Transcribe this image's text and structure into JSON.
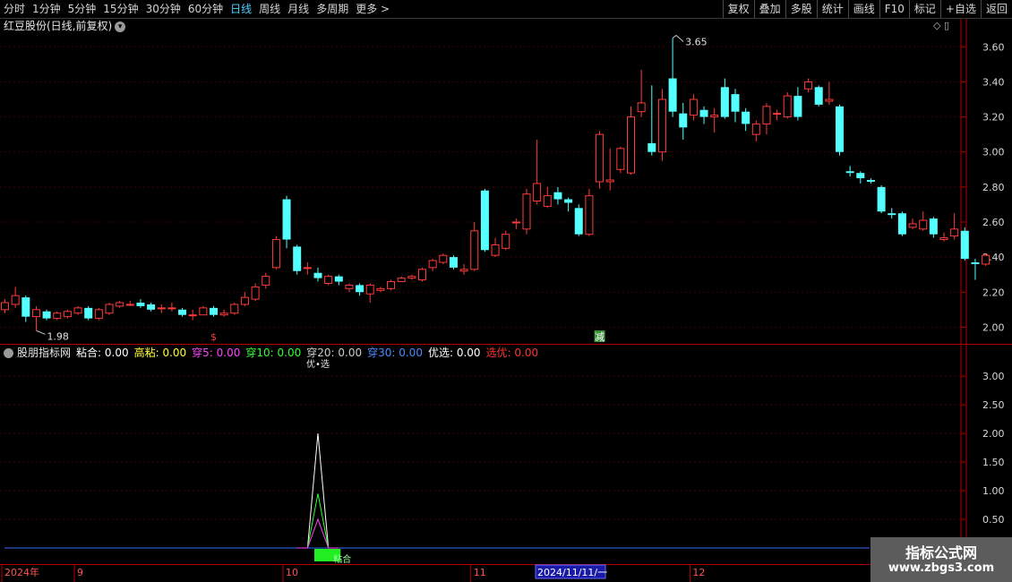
{
  "toolbar": {
    "periods": [
      "分时",
      "1分钟",
      "5分钟",
      "15分钟",
      "30分钟",
      "60分钟",
      "日线",
      "周线",
      "月线",
      "多周期",
      "更多 >"
    ],
    "active_period": "日线",
    "tools": [
      "复权",
      "叠加",
      "多股",
      "统计",
      "画线",
      "F10",
      "标记",
      "+自选",
      "返回"
    ]
  },
  "chart_header": {
    "title": "红豆股份(日线,前复权)",
    "icons": "◇ ▯"
  },
  "colors": {
    "up": "#ff3a3a",
    "down": "#54ffff",
    "axis": "#b30000",
    "grid": "#3a0000"
  },
  "chart_data": [
    {
      "type": "candlestick",
      "title": "红豆股份(日线,前复权)",
      "y_ticks": [
        "3.60",
        "3.40",
        "3.20",
        "3.00",
        "2.80",
        "2.60",
        "2.40",
        "2.20",
        "2.00"
      ],
      "ylim": [
        1.91,
        3.76
      ],
      "annotations": {
        "high": "3.65",
        "low": "1.98"
      },
      "signal_markers": [
        {
          "index": 20,
          "label": "$",
          "color": "#ff3a3a"
        },
        {
          "index": 57,
          "label": "减",
          "color": "#ffffff"
        }
      ],
      "candles": [
        {
          "o": 2.1,
          "c": 2.14,
          "h": 2.16,
          "l": 2.08
        },
        {
          "o": 2.13,
          "c": 2.18,
          "h": 2.23,
          "l": 2.11
        },
        {
          "o": 2.17,
          "c": 2.06,
          "h": 2.18,
          "l": 2.03
        },
        {
          "o": 2.06,
          "c": 2.1,
          "h": 2.12,
          "l": 1.98
        },
        {
          "o": 2.09,
          "c": 2.05,
          "h": 2.1,
          "l": 2.04
        },
        {
          "o": 2.05,
          "c": 2.08,
          "h": 2.09,
          "l": 2.04
        },
        {
          "o": 2.06,
          "c": 2.09,
          "h": 2.1,
          "l": 2.05
        },
        {
          "o": 2.08,
          "c": 2.11,
          "h": 2.12,
          "l": 2.07
        },
        {
          "o": 2.11,
          "c": 2.05,
          "h": 2.12,
          "l": 2.04
        },
        {
          "o": 2.05,
          "c": 2.1,
          "h": 2.11,
          "l": 2.04
        },
        {
          "o": 2.08,
          "c": 2.13,
          "h": 2.14,
          "l": 2.07
        },
        {
          "o": 2.12,
          "c": 2.14,
          "h": 2.15,
          "l": 2.11
        },
        {
          "o": 2.13,
          "c": 2.13,
          "h": 2.15,
          "l": 2.12
        },
        {
          "o": 2.14,
          "c": 2.12,
          "h": 2.16,
          "l": 2.11
        },
        {
          "o": 2.13,
          "c": 2.1,
          "h": 2.14,
          "l": 2.09
        },
        {
          "o": 2.11,
          "c": 2.11,
          "h": 2.13,
          "l": 2.08
        },
        {
          "o": 2.11,
          "c": 2.11,
          "h": 2.14,
          "l": 2.09
        },
        {
          "o": 2.1,
          "c": 2.07,
          "h": 2.11,
          "l": 2.06
        },
        {
          "o": 2.07,
          "c": 2.07,
          "h": 2.1,
          "l": 2.04
        },
        {
          "o": 2.07,
          "c": 2.11,
          "h": 2.12,
          "l": 2.07
        },
        {
          "o": 2.11,
          "c": 2.07,
          "h": 2.12,
          "l": 2.06
        },
        {
          "o": 2.07,
          "c": 2.08,
          "h": 2.1,
          "l": 2.06
        },
        {
          "o": 2.08,
          "c": 2.13,
          "h": 2.14,
          "l": 2.07
        },
        {
          "o": 2.13,
          "c": 2.17,
          "h": 2.2,
          "l": 2.12
        },
        {
          "o": 2.16,
          "c": 2.23,
          "h": 2.25,
          "l": 2.15
        },
        {
          "o": 2.24,
          "c": 2.29,
          "h": 2.31,
          "l": 2.22
        },
        {
          "o": 2.34,
          "c": 2.5,
          "h": 2.52,
          "l": 2.33
        },
        {
          "o": 2.73,
          "c": 2.5,
          "h": 2.75,
          "l": 2.45
        },
        {
          "o": 2.46,
          "c": 2.32,
          "h": 2.47,
          "l": 2.3
        },
        {
          "o": 2.34,
          "c": 2.34,
          "h": 2.37,
          "l": 2.3
        },
        {
          "o": 2.31,
          "c": 2.28,
          "h": 2.34,
          "l": 2.26
        },
        {
          "o": 2.25,
          "c": 2.29,
          "h": 2.3,
          "l": 2.24
        },
        {
          "o": 2.29,
          "c": 2.26,
          "h": 2.3,
          "l": 2.24
        },
        {
          "o": 2.22,
          "c": 2.24,
          "h": 2.25,
          "l": 2.2
        },
        {
          "o": 2.24,
          "c": 2.2,
          "h": 2.25,
          "l": 2.18
        },
        {
          "o": 2.19,
          "c": 2.24,
          "h": 2.25,
          "l": 2.14
        },
        {
          "o": 2.21,
          "c": 2.22,
          "h": 2.23,
          "l": 2.2
        },
        {
          "o": 2.22,
          "c": 2.26,
          "h": 2.27,
          "l": 2.21
        },
        {
          "o": 2.26,
          "c": 2.28,
          "h": 2.29,
          "l": 2.26
        },
        {
          "o": 2.28,
          "c": 2.29,
          "h": 2.3,
          "l": 2.27
        },
        {
          "o": 2.27,
          "c": 2.33,
          "h": 2.34,
          "l": 2.26
        },
        {
          "o": 2.34,
          "c": 2.38,
          "h": 2.39,
          "l": 2.32
        },
        {
          "o": 2.37,
          "c": 2.41,
          "h": 2.42,
          "l": 2.36
        },
        {
          "o": 2.4,
          "c": 2.34,
          "h": 2.41,
          "l": 2.33
        },
        {
          "o": 2.32,
          "c": 2.33,
          "h": 2.36,
          "l": 2.3
        },
        {
          "o": 2.33,
          "c": 2.55,
          "h": 2.6,
          "l": 2.32
        },
        {
          "o": 2.78,
          "c": 2.44,
          "h": 2.79,
          "l": 2.43
        },
        {
          "o": 2.41,
          "c": 2.47,
          "h": 2.51,
          "l": 2.4
        },
        {
          "o": 2.45,
          "c": 2.53,
          "h": 2.55,
          "l": 2.44
        },
        {
          "o": 2.6,
          "c": 2.6,
          "h": 2.62,
          "l": 2.56
        },
        {
          "o": 2.56,
          "c": 2.76,
          "h": 2.79,
          "l": 2.53
        },
        {
          "o": 2.72,
          "c": 2.82,
          "h": 3.07,
          "l": 2.7
        },
        {
          "o": 2.69,
          "c": 2.75,
          "h": 2.8,
          "l": 2.68
        },
        {
          "o": 2.77,
          "c": 2.73,
          "h": 2.8,
          "l": 2.7
        },
        {
          "o": 2.73,
          "c": 2.71,
          "h": 2.74,
          "l": 2.66
        },
        {
          "o": 2.68,
          "c": 2.53,
          "h": 2.7,
          "l": 2.52
        },
        {
          "o": 2.53,
          "c": 2.75,
          "h": 2.79,
          "l": 2.52
        },
        {
          "o": 2.83,
          "c": 3.1,
          "h": 3.12,
          "l": 2.79
        },
        {
          "o": 2.83,
          "c": 2.84,
          "h": 3.02,
          "l": 2.78
        },
        {
          "o": 2.9,
          "c": 3.02,
          "h": 3.03,
          "l": 2.88
        },
        {
          "o": 2.88,
          "c": 3.2,
          "h": 3.26,
          "l": 2.87
        },
        {
          "o": 3.23,
          "c": 3.28,
          "h": 3.47,
          "l": 3.2
        },
        {
          "o": 3.05,
          "c": 3.0,
          "h": 3.38,
          "l": 2.98
        },
        {
          "o": 3.0,
          "c": 3.3,
          "h": 3.36,
          "l": 2.95
        },
        {
          "o": 3.42,
          "c": 3.23,
          "h": 3.65,
          "l": 3.2
        },
        {
          "o": 3.22,
          "c": 3.14,
          "h": 3.28,
          "l": 3.07
        },
        {
          "o": 3.21,
          "c": 3.3,
          "h": 3.33,
          "l": 3.18
        },
        {
          "o": 3.24,
          "c": 3.2,
          "h": 3.26,
          "l": 3.16
        },
        {
          "o": 3.2,
          "c": 3.21,
          "h": 3.25,
          "l": 3.11
        },
        {
          "o": 3.37,
          "c": 3.2,
          "h": 3.42,
          "l": 3.19
        },
        {
          "o": 3.33,
          "c": 3.23,
          "h": 3.36,
          "l": 3.17
        },
        {
          "o": 3.23,
          "c": 3.16,
          "h": 3.25,
          "l": 3.12
        },
        {
          "o": 3.1,
          "c": 3.16,
          "h": 3.18,
          "l": 3.06
        },
        {
          "o": 3.16,
          "c": 3.26,
          "h": 3.28,
          "l": 3.1
        },
        {
          "o": 3.22,
          "c": 3.22,
          "h": 3.24,
          "l": 3.18
        },
        {
          "o": 3.2,
          "c": 3.32,
          "h": 3.34,
          "l": 3.19
        },
        {
          "o": 3.32,
          "c": 3.2,
          "h": 3.37,
          "l": 3.18
        },
        {
          "o": 3.36,
          "c": 3.4,
          "h": 3.42,
          "l": 3.34
        },
        {
          "o": 3.37,
          "c": 3.27,
          "h": 3.38,
          "l": 3.26
        },
        {
          "o": 3.29,
          "c": 3.3,
          "h": 3.4,
          "l": 3.27
        },
        {
          "o": 3.26,
          "c": 3.0,
          "h": 3.27,
          "l": 2.98
        },
        {
          "o": 2.89,
          "c": 2.88,
          "h": 2.92,
          "l": 2.86
        },
        {
          "o": 2.88,
          "c": 2.85,
          "h": 2.89,
          "l": 2.82
        },
        {
          "o": 2.84,
          "c": 2.83,
          "h": 2.85,
          "l": 2.82
        },
        {
          "o": 2.8,
          "c": 2.66,
          "h": 2.81,
          "l": 2.65
        },
        {
          "o": 2.65,
          "c": 2.64,
          "h": 2.68,
          "l": 2.62
        },
        {
          "o": 2.65,
          "c": 2.53,
          "h": 2.66,
          "l": 2.52
        },
        {
          "o": 2.57,
          "c": 2.59,
          "h": 2.62,
          "l": 2.56
        },
        {
          "o": 2.56,
          "c": 2.61,
          "h": 2.66,
          "l": 2.55
        },
        {
          "o": 2.62,
          "c": 2.53,
          "h": 2.63,
          "l": 2.51
        },
        {
          "o": 2.5,
          "c": 2.51,
          "h": 2.54,
          "l": 2.49
        },
        {
          "o": 2.52,
          "c": 2.56,
          "h": 2.65,
          "l": 2.5
        },
        {
          "o": 2.55,
          "c": 2.39,
          "h": 2.57,
          "l": 2.38
        },
        {
          "o": 2.37,
          "c": 2.36,
          "h": 2.39,
          "l": 2.27
        },
        {
          "o": 2.36,
          "c": 2.41,
          "h": 2.42,
          "l": 2.35
        }
      ]
    },
    {
      "type": "line",
      "title": "股朋指标网",
      "y_ticks": [
        "3.00",
        "2.50",
        "2.00",
        "1.50",
        "1.00",
        "0.50"
      ],
      "ylim": [
        0,
        3.3
      ],
      "x": [
        28,
        29,
        30,
        31,
        32
      ],
      "series": [
        {
          "name": "粘合",
          "color": "#ffffff",
          "values": [
            0,
            0,
            2.0,
            0,
            0
          ]
        },
        {
          "name": "穿10",
          "color": "#33ff33",
          "values": [
            0,
            0,
            0.95,
            0,
            0
          ]
        },
        {
          "name": "穿5",
          "color": "#ff44ff",
          "values": [
            0,
            0,
            0.5,
            0,
            0
          ]
        }
      ],
      "baseline": {
        "value": 0.0,
        "color": "#2f6bff"
      },
      "bar_marker": {
        "from": 30,
        "to": 32,
        "label": "粘合",
        "color": "#22ee22"
      },
      "top_marker": "优•选",
      "legend": [
        {
          "text": "粘合: 0.00",
          "color": "#ffffff"
        },
        {
          "text": "高粘: 0.00",
          "color": "#ffff33"
        },
        {
          "text": "穿5: 0.00",
          "color": "#ff44ff"
        },
        {
          "text": "穿10: 0.00",
          "color": "#33ff33"
        },
        {
          "text": "穿20: 0.00",
          "color": "#cccccc"
        },
        {
          "text": "穿30: 0.00",
          "color": "#4b8bff"
        },
        {
          "text": "优选: 0.00",
          "color": "#ffffff"
        },
        {
          "text": "选优: 0.00",
          "color": "#ff3333"
        }
      ]
    }
  ],
  "indicator_title": "股朋指标网",
  "x_axis_labels": [
    {
      "label": "2024年",
      "index": 0
    },
    {
      "label": "9",
      "index": 7
    },
    {
      "label": "10",
      "index": 27
    },
    {
      "label": "11",
      "index": 45
    },
    {
      "label": "12",
      "index": 66
    }
  ],
  "date_cursor": "2024/11/11/一",
  "watermark": {
    "title": "指标公式网",
    "url": "www.zbgs3.com"
  }
}
